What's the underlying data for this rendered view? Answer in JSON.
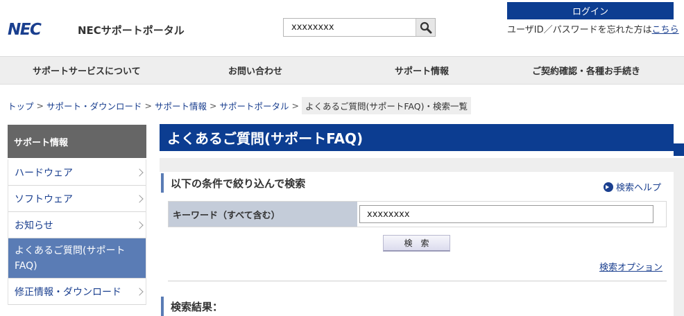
{
  "header": {
    "logo": "NEC",
    "site_title": "NECサポートポータル",
    "search_value": "xxxxxxxx",
    "login_label": "ログイン",
    "forgot_text": "ユーザID／パスワードを忘れた方は",
    "forgot_link": "こちら"
  },
  "gnav": [
    {
      "label": "サポートサービスについて"
    },
    {
      "label": "お問い合わせ"
    },
    {
      "label": "サポート情報"
    },
    {
      "label": "ご契約確認・各種お手続き"
    }
  ],
  "breadcrumb": {
    "items": [
      "トップ",
      "サポート・ダウンロード",
      "サポート情報",
      "サポートポータル"
    ],
    "separator": ">",
    "current": "よくあるご質問(サポートFAQ)・検索一覧"
  },
  "sidebar": {
    "heading": "サポート情報",
    "items": [
      {
        "label": "ハードウェア"
      },
      {
        "label": "ソフトウェア"
      },
      {
        "label": "お知らせ"
      },
      {
        "label": "よくあるご質問(サポートFAQ)"
      },
      {
        "label": "修正情報・ダウンロード"
      }
    ]
  },
  "main": {
    "title": "よくあるご質問(サポートFAQ)",
    "filter_heading": "以下の条件で絞り込んで検索",
    "help_link": "検索ヘルプ",
    "keyword_label": "キーワード（すべて含む）",
    "keyword_value": "xxxxxxxx",
    "search_button": "検索",
    "options_link": "検索オプション",
    "results_heading": "検索結果："
  },
  "colors": {
    "brand_blue": "#0c3d91",
    "sidebar_active": "#5a7cb5",
    "link": "#1a3f8f"
  }
}
